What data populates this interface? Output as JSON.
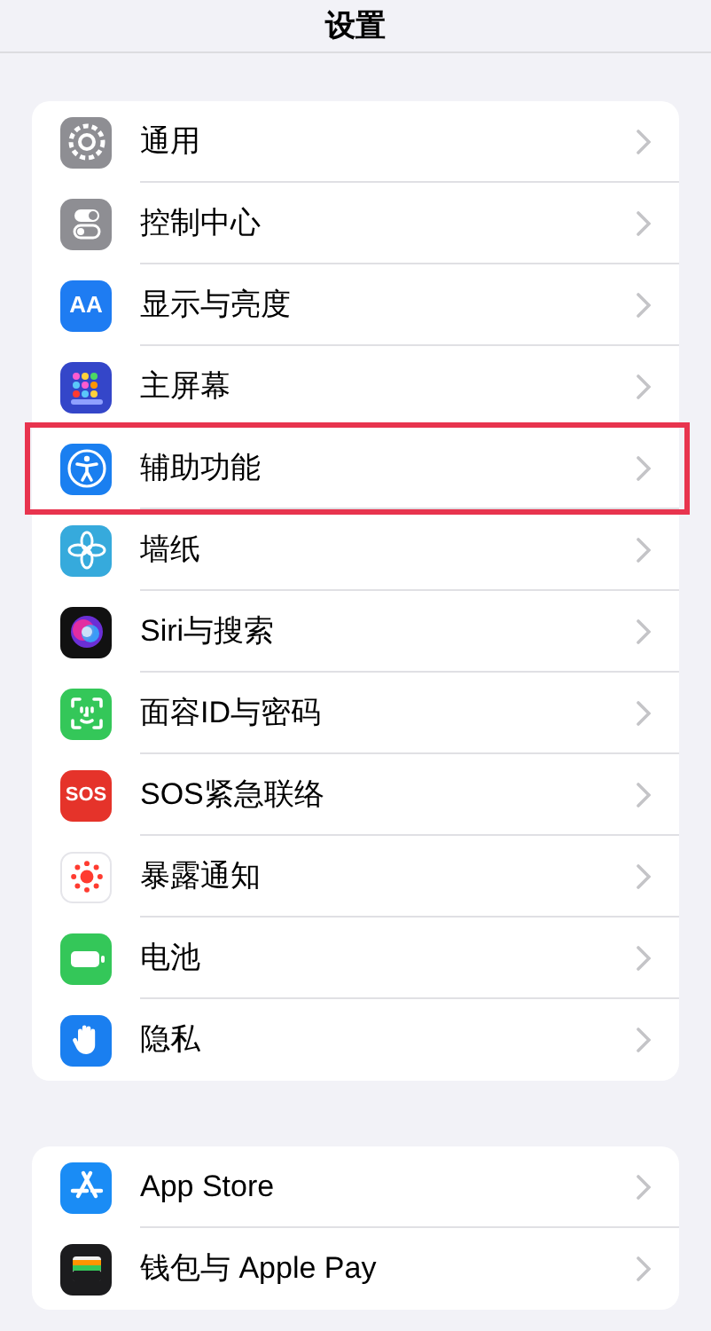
{
  "title": "设置",
  "groups": [
    {
      "items": [
        {
          "kind": "general",
          "label": "通用",
          "highlighted": false
        },
        {
          "kind": "control",
          "label": "控制中心",
          "highlighted": false
        },
        {
          "kind": "display",
          "label": "显示与亮度",
          "icon_text": "AA",
          "highlighted": false
        },
        {
          "kind": "home",
          "label": "主屏幕",
          "highlighted": false
        },
        {
          "kind": "accessibility",
          "label": "辅助功能",
          "highlighted": true
        },
        {
          "kind": "wallpaper",
          "label": "墙纸",
          "highlighted": false
        },
        {
          "kind": "siri",
          "label": "Siri与搜索",
          "highlighted": false
        },
        {
          "kind": "faceid",
          "label": "面容ID与密码",
          "highlighted": false
        },
        {
          "kind": "sos",
          "label": "SOS紧急联络",
          "icon_text": "SOS",
          "highlighted": false
        },
        {
          "kind": "exposure",
          "label": "暴露通知",
          "highlighted": false
        },
        {
          "kind": "battery",
          "label": "电池",
          "highlighted": false
        },
        {
          "kind": "privacy",
          "label": "隐私",
          "highlighted": false
        }
      ]
    },
    {
      "items": [
        {
          "kind": "appstore",
          "label": "App Store",
          "highlighted": false
        },
        {
          "kind": "wallet",
          "label": "钱包与 Apple Pay",
          "highlighted": false
        }
      ]
    }
  ]
}
